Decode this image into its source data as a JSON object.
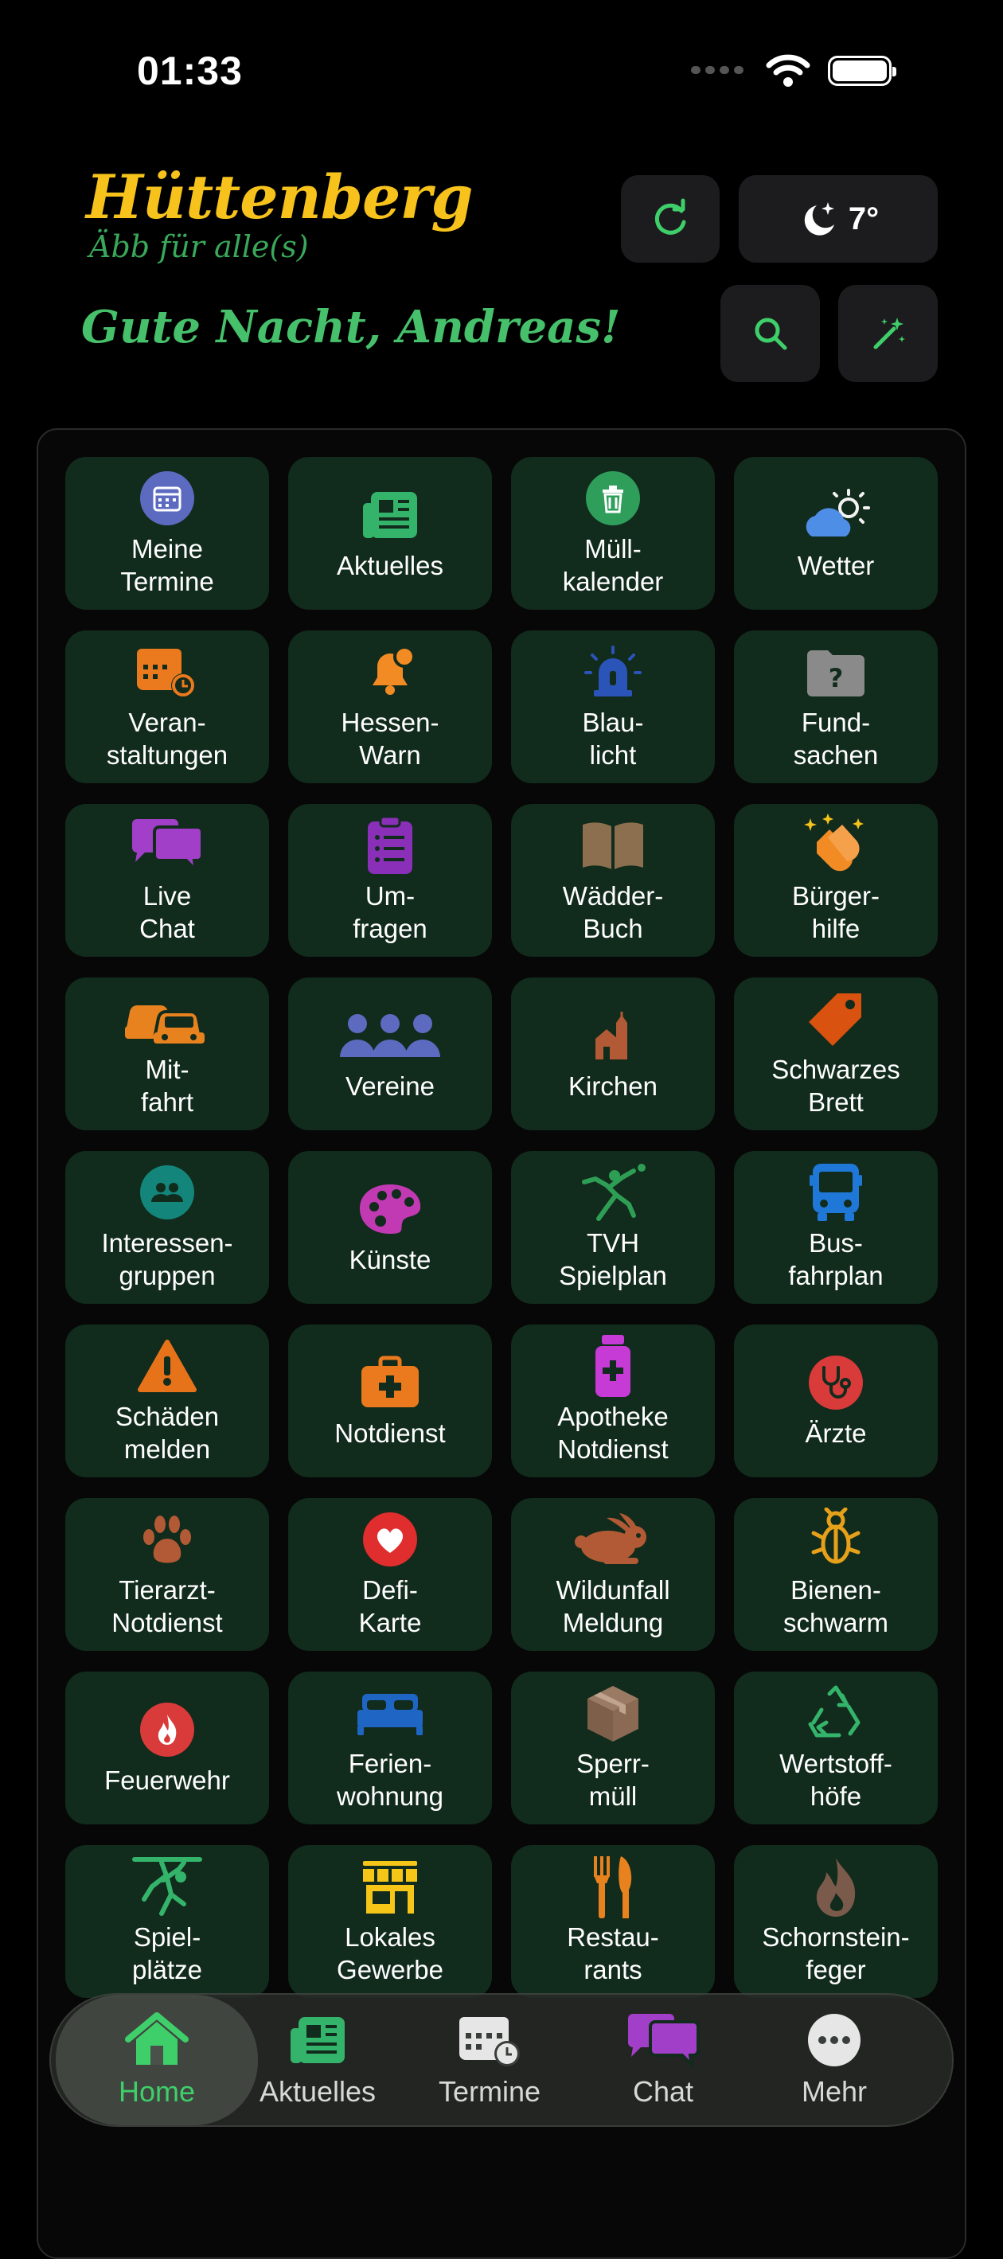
{
  "status": {
    "time": "01:33"
  },
  "header": {
    "brand_title": "Hüttenberg",
    "brand_subtitle": "Äbb für alle(s)",
    "greeting": "Gute Nacht, Andreas!",
    "weather": "7°"
  },
  "tiles": [
    {
      "label": "Meine\nTermine",
      "icon": "calendar-icon"
    },
    {
      "label": "Aktuelles",
      "icon": "newspaper-icon"
    },
    {
      "label": "Müll-\nkalender",
      "icon": "trash-icon"
    },
    {
      "label": "Wetter",
      "icon": "cloud-sun-icon"
    },
    {
      "label": "Veran-\nstaltungen",
      "icon": "event-calendar-icon"
    },
    {
      "label": "Hessen-\nWarn",
      "icon": "bell-icon"
    },
    {
      "label": "Blau-\nlicht",
      "icon": "siren-icon"
    },
    {
      "label": "Fund-\nsachen",
      "icon": "folder-question-icon"
    },
    {
      "label": "Live\nChat",
      "icon": "chat-bubbles-icon"
    },
    {
      "label": "Um-\nfragen",
      "icon": "clipboard-icon"
    },
    {
      "label": "Wädder-\nBuch",
      "icon": "book-icon"
    },
    {
      "label": "Bürger-\nhilfe",
      "icon": "clapping-hands-icon"
    },
    {
      "label": "Mit-\nfahrt",
      "icon": "cars-icon"
    },
    {
      "label": "Vereine",
      "icon": "people-group-icon"
    },
    {
      "label": "Kirchen",
      "icon": "church-icon"
    },
    {
      "label": "Schwarzes\nBrett",
      "icon": "tag-icon"
    },
    {
      "label": "Interessen-\ngruppen",
      "icon": "group-circle-icon"
    },
    {
      "label": "Künste",
      "icon": "palette-icon"
    },
    {
      "label": "TVH\nSpielplan",
      "icon": "handball-player-icon"
    },
    {
      "label": "Bus-\nfahrplan",
      "icon": "bus-icon"
    },
    {
      "label": "Schäden\nmelden",
      "icon": "warning-triangle-icon"
    },
    {
      "label": "Notdienst",
      "icon": "medical-kit-icon"
    },
    {
      "label": "Apotheke\nNotdienst",
      "icon": "medicine-bottle-icon"
    },
    {
      "label": "Ärzte",
      "icon": "stethoscope-icon"
    },
    {
      "label": "Tierarzt-\nNotdienst",
      "icon": "paw-icon"
    },
    {
      "label": "Defi-\nKarte",
      "icon": "heart-icon"
    },
    {
      "label": "Wildunfall\nMeldung",
      "icon": "rabbit-icon"
    },
    {
      "label": "Bienen-\nschwarm",
      "icon": "bug-icon"
    },
    {
      "label": "Feuerwehr",
      "icon": "fire-icon"
    },
    {
      "label": "Ferien-\nwohnung",
      "icon": "bed-icon"
    },
    {
      "label": "Sperr-\nmüll",
      "icon": "box-icon"
    },
    {
      "label": "Wertstoff-\nhöfe",
      "icon": "recycle-icon"
    },
    {
      "label": "Spiel-\nplätze",
      "icon": "playground-icon"
    },
    {
      "label": "Lokales\nGewerbe",
      "icon": "shop-icon"
    },
    {
      "label": "Restau-\nrants",
      "icon": "fork-knife-icon"
    },
    {
      "label": "Schornstein-\nfeger",
      "icon": "flame-icon"
    }
  ],
  "tabs": [
    {
      "label": "Home",
      "icon": "home-icon",
      "active": true
    },
    {
      "label": "Aktuelles",
      "icon": "newspaper-icon"
    },
    {
      "label": "Termine",
      "icon": "calendar-clock-icon"
    },
    {
      "label": "Chat",
      "icon": "chat-bubbles-icon"
    },
    {
      "label": "Mehr",
      "icon": "more-dots-icon"
    }
  ],
  "colors": {
    "background": "#000000",
    "tile": "#112b1c",
    "accent_green": "#46c06a",
    "brand_yellow": "#f6c21b"
  }
}
